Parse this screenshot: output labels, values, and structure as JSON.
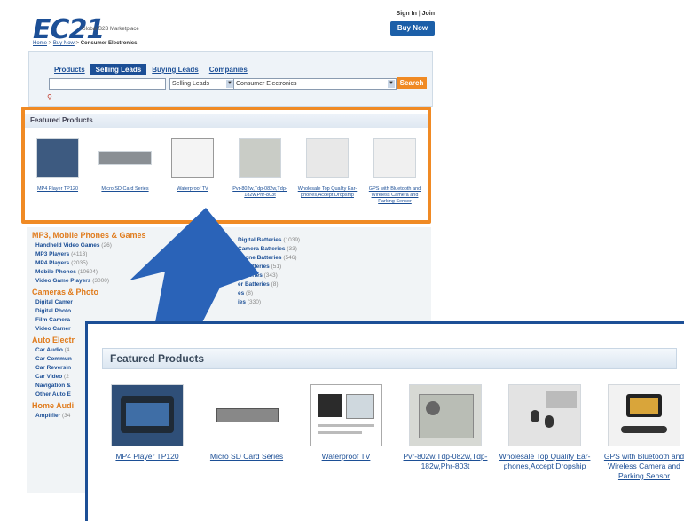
{
  "bg": {
    "logo": "EC21",
    "logo_tagline": "Global B2B Marketplace",
    "signin": "Sign In",
    "join": "Join",
    "buy_now": "Buy Now",
    "breadcrumb": [
      "Home",
      "Buy Now",
      "Consumer Electronics"
    ],
    "search_tabs": [
      "Products",
      "Selling Leads",
      "Buying Leads",
      "Companies"
    ],
    "search_type": "Selling Leads",
    "search_category": "Consumer Electronics",
    "search_button": "Search",
    "featured_title": "Featured Products",
    "featured_items": [
      "MP4 Player TP120",
      "Micro SD Card Series",
      "Waterproof TV",
      "Pvr-802w,Tdp-082w,Tdp-182w,Phr-803t",
      "Wholesale Top Quality Ear-phones,Accept Dropship",
      "GPS with Bluetooth and Wireless Camera and Parking Sensor"
    ],
    "consumer_electronics": "Consumer Electronics",
    "cat_groups": [
      {
        "title": "MP3, Mobile Phones & Games",
        "items": [
          {
            "name": "Handheld Video Games",
            "count": "(26)"
          },
          {
            "name": "MP3 Players",
            "count": "(4113)"
          },
          {
            "name": "MP4 Players",
            "count": "(2035)"
          },
          {
            "name": "Mobile Phones",
            "count": "(10604)"
          },
          {
            "name": "Video Game Players",
            "count": "(3000)"
          }
        ]
      },
      {
        "title": "Cameras & Photo",
        "items": [
          {
            "name": "Digital Camer",
            "count": ""
          },
          {
            "name": "Digital Photo",
            "count": ""
          },
          {
            "name": "Film Camera",
            "count": ""
          },
          {
            "name": "Video Camer",
            "count": ""
          }
        ]
      },
      {
        "title": "Auto Electr",
        "items": [
          {
            "name": "Car Audio",
            "count": "(4"
          },
          {
            "name": "Car Commun",
            "count": ""
          },
          {
            "name": "Car Reversin",
            "count": ""
          },
          {
            "name": "Car Video",
            "count": "(2"
          },
          {
            "name": "Navigation &",
            "count": ""
          },
          {
            "name": "Other Auto E",
            "count": ""
          }
        ]
      },
      {
        "title": "Home Audi",
        "items": [
          {
            "name": "Amplifier",
            "count": "(34"
          }
        ]
      }
    ],
    "right_items": [
      {
        "name": "Digital Batteries",
        "count": "(1039)"
      },
      {
        "name": "Camera Batteries",
        "count": "(33)"
      },
      {
        "name": "Phone Batteries",
        "count": "(546)"
      },
      {
        "name": "er Batteries",
        "count": "(51)"
      },
      {
        "name": "Batteries",
        "count": "(343)"
      },
      {
        "name": "er Batteries",
        "count": "(8)"
      },
      {
        "name": "es",
        "count": "(8)"
      },
      {
        "name": "ies",
        "count": "(330)"
      }
    ]
  },
  "zoom": {
    "title": "Featured Products",
    "items": [
      {
        "label": "MP4 Player TP120",
        "icon": "mp4-player-image"
      },
      {
        "label": "Micro SD Card Series",
        "icon": "sd-card-image"
      },
      {
        "label": "Waterproof TV",
        "icon": "waterproof-tv-image"
      },
      {
        "label": "Pvr-802w,Tdp-082w,Tdp-182w,Phr-803t",
        "icon": "circuit-board-image"
      },
      {
        "label": "Wholesale Top Quality Ear-phones,Accept Dropship",
        "icon": "earphones-image"
      },
      {
        "label": "GPS with Bluetooth and Wireless Camera and Parking Sensor",
        "icon": "gps-image"
      }
    ]
  },
  "colors": {
    "brand_blue": "#1c4f96",
    "highlight_orange": "#f08a24",
    "arrow_blue": "#2a63b8"
  }
}
